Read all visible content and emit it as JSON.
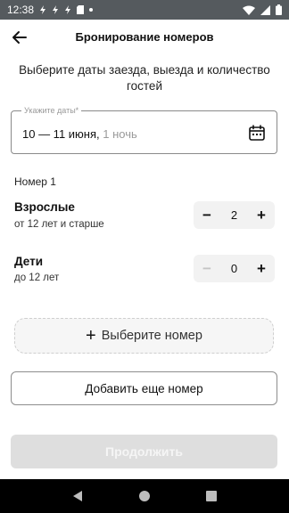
{
  "status_bar": {
    "time": "12:38",
    "icons_left": [
      "notification-icon",
      "notification-icon",
      "notification-icon",
      "sd-card-icon",
      "dot-icon"
    ],
    "icons_right": [
      "wifi-icon",
      "signal-icon",
      "battery-icon"
    ]
  },
  "header": {
    "title": "Бронирование номеров",
    "back_icon": "arrow-back-icon"
  },
  "subtitle": "Выберите даты заезда, выезда и количество гостей",
  "date_field": {
    "label": "Укажите даты*",
    "value": "10 — 11 июня,",
    "nights": "1 ночь",
    "icon": "calendar-icon"
  },
  "room": {
    "title": "Номер 1",
    "adults": {
      "label": "Взрослые",
      "sub": "от 12 лет и старше",
      "count": "2",
      "minus": "−",
      "plus": "+"
    },
    "children": {
      "label": "Дети",
      "sub": "до 12 лет",
      "count": "0",
      "minus": "−",
      "plus": "+"
    }
  },
  "buttons": {
    "select_room": "Выберите номер",
    "select_room_plus": "+",
    "add_room": "Добавить еще номер",
    "continue": "Продолжить"
  },
  "colors": {
    "status_bar_bg": "#555a5e",
    "stepper_bg": "#f2f2f2",
    "continue_disabled_bg": "#dedede"
  }
}
